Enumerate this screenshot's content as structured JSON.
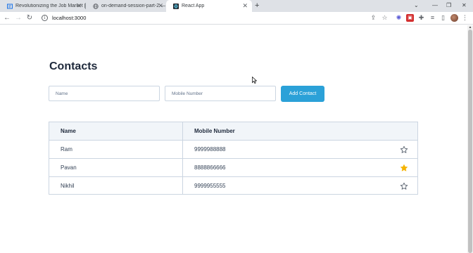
{
  "browser": {
    "tabs": [
      {
        "title": "Revolutionizing the Job Market |",
        "active": false,
        "icon": "doc-icon"
      },
      {
        "title": "on-demand-session-part-2 — C",
        "active": false,
        "icon": "globe-icon"
      },
      {
        "title": "React App",
        "active": true,
        "icon": "react-icon"
      }
    ],
    "new_tab": "+",
    "address": "localhost:3000"
  },
  "page": {
    "heading": "Contacts",
    "form": {
      "name_placeholder": "Name",
      "mobile_placeholder": "Mobile Number",
      "add_button": "Add Contact"
    },
    "table": {
      "headers": [
        "Name",
        "Mobile Number"
      ],
      "rows": [
        {
          "name": "Ram",
          "mobile": "9999988888",
          "starred": false
        },
        {
          "name": "Pavan",
          "mobile": "8888866666",
          "starred": true
        },
        {
          "name": "Nikhil",
          "mobile": "9999955555",
          "starred": false
        }
      ]
    }
  },
  "colors": {
    "accent": "#2ba1d8",
    "star_active": "#f5b301",
    "star_inactive": "#4b5563",
    "header_bg": "#f1f5f9",
    "border": "#cbd5e1"
  }
}
